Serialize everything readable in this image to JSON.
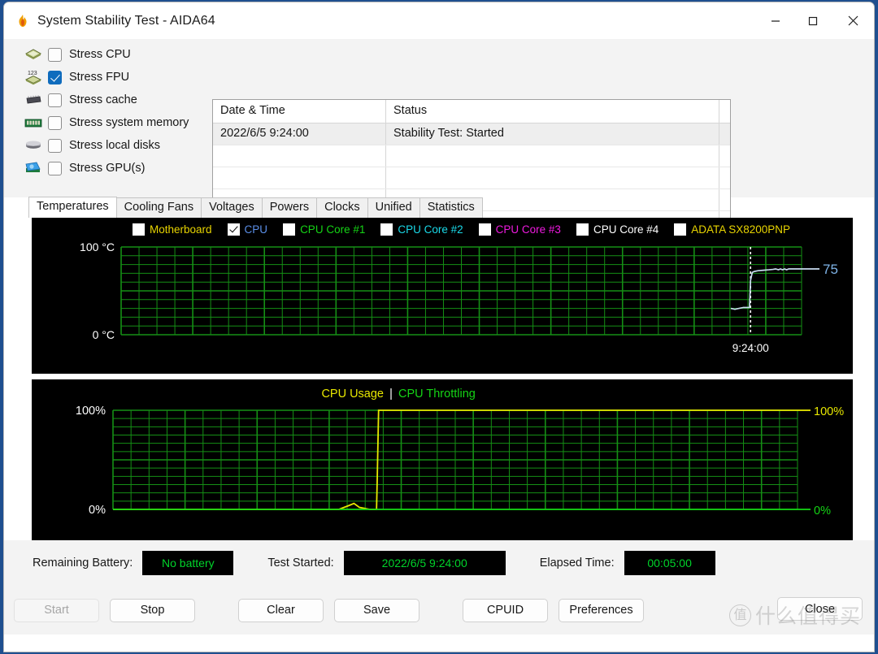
{
  "window": {
    "title": "System Stability Test - AIDA64",
    "icon": "flame-icon",
    "controls": {
      "minimize": "—",
      "maximize": "☐",
      "close": "✕"
    }
  },
  "stress_options": [
    {
      "label": "Stress CPU",
      "checked": false,
      "icon": "cpu-chip-icon"
    },
    {
      "label": "Stress FPU",
      "checked": true,
      "icon": "fpu-chip-icon"
    },
    {
      "label": "Stress cache",
      "checked": false,
      "icon": "cache-chip-icon"
    },
    {
      "label": "Stress system memory",
      "checked": false,
      "icon": "memory-module-icon"
    },
    {
      "label": "Stress local disks",
      "checked": false,
      "icon": "hard-disk-icon"
    },
    {
      "label": "Stress GPU(s)",
      "checked": false,
      "icon": "gpu-card-icon"
    }
  ],
  "log_table": {
    "columns": [
      "Date & Time",
      "Status"
    ],
    "rows": [
      {
        "datetime": "2022/6/5 9:24:00",
        "status": "Stability Test: Started",
        "selected": true
      },
      {
        "datetime": "",
        "status": "",
        "selected": false
      },
      {
        "datetime": "",
        "status": "",
        "selected": false
      },
      {
        "datetime": "",
        "status": "",
        "selected": false
      },
      {
        "datetime": "",
        "status": "",
        "selected": false
      }
    ]
  },
  "tabs": [
    {
      "label": "Temperatures",
      "active": true
    },
    {
      "label": "Cooling Fans",
      "active": false
    },
    {
      "label": "Voltages",
      "active": false
    },
    {
      "label": "Powers",
      "active": false
    },
    {
      "label": "Clocks",
      "active": false
    },
    {
      "label": "Unified",
      "active": false
    },
    {
      "label": "Statistics",
      "active": false
    }
  ],
  "temperature_legend": [
    {
      "label": "Motherboard",
      "checked": false,
      "color": "#e8d400"
    },
    {
      "label": "CPU",
      "checked": true,
      "color": "#5b8fe8"
    },
    {
      "label": "CPU Core #1",
      "checked": false,
      "color": "#15d415"
    },
    {
      "label": "CPU Core #2",
      "checked": false,
      "color": "#1ad9e8"
    },
    {
      "label": "CPU Core #3",
      "checked": false,
      "color": "#f01ae0"
    },
    {
      "label": "CPU Core #4",
      "checked": false,
      "color": "#ffffff"
    },
    {
      "label": "ADATA SX8200PNP",
      "checked": false,
      "color": "#e8d400"
    }
  ],
  "usage_legend": [
    {
      "label": "CPU Usage",
      "color": "#e8e800"
    },
    {
      "label": "|",
      "color": "#ffffff"
    },
    {
      "label": "CPU Throttling",
      "color": "#15d415"
    }
  ],
  "status_fields": [
    {
      "label": "Remaining Battery:",
      "value": "No battery",
      "value_color": "#00d42a"
    },
    {
      "label": "Test Started:",
      "value": "2022/6/5 9:24:00",
      "value_color": "#00d42a"
    },
    {
      "label": "Elapsed Time:",
      "value": "00:05:00",
      "value_color": "#00d42a"
    }
  ],
  "buttons": [
    {
      "label": "Start",
      "disabled": true
    },
    {
      "label": "Stop",
      "disabled": false
    },
    {
      "label": "Clear",
      "disabled": false
    },
    {
      "label": "Save",
      "disabled": false
    },
    {
      "label": "CPUID",
      "disabled": false
    },
    {
      "label": "Preferences",
      "disabled": false
    },
    {
      "label": "Close",
      "disabled": false
    }
  ],
  "watermark": {
    "mark": "值",
    "text": "什么值得买"
  },
  "chart_data": [
    {
      "type": "line",
      "title": "Temperatures",
      "id": "temperature-graph",
      "ylabel": "",
      "ytick_labels": [
        "100 °C",
        "0 °C"
      ],
      "ylim": [
        0,
        100
      ],
      "xlabel": "",
      "xtick_labels": [
        "9:24:00"
      ],
      "grid": true,
      "grid_color": "#158f15",
      "background": "#000000",
      "marker_line": {
        "label": "9:24:00",
        "x_fraction": 0.925,
        "style": "dotted-white"
      },
      "right_value_label": {
        "text": "75",
        "color": "#7fb4e8"
      },
      "series": [
        {
          "name": "CPU",
          "color": "#c8dcf0",
          "current_value": 75,
          "points": [
            {
              "x": 0.896,
              "y": 30
            },
            {
              "x": 0.902,
              "y": 29
            },
            {
              "x": 0.908,
              "y": 30
            },
            {
              "x": 0.914,
              "y": 31
            },
            {
              "x": 0.92,
              "y": 31
            },
            {
              "x": 0.9235,
              "y": 31
            },
            {
              "x": 0.925,
              "y": 62
            },
            {
              "x": 0.9275,
              "y": 71
            },
            {
              "x": 0.93,
              "y": 72
            },
            {
              "x": 0.936,
              "y": 73
            },
            {
              "x": 0.944,
              "y": 73.5
            },
            {
              "x": 0.952,
              "y": 74
            },
            {
              "x": 0.958,
              "y": 74.5
            },
            {
              "x": 0.962,
              "y": 75
            },
            {
              "x": 0.966,
              "y": 74
            },
            {
              "x": 0.969,
              "y": 75
            },
            {
              "x": 0.972,
              "y": 74
            },
            {
              "x": 0.975,
              "y": 75
            },
            {
              "x": 0.978,
              "y": 74
            },
            {
              "x": 0.981,
              "y": 75
            },
            {
              "x": 0.99,
              "y": 75
            },
            {
              "x": 1.0,
              "y": 75
            }
          ]
        }
      ]
    },
    {
      "type": "line",
      "title": "CPU Usage | CPU Throttling",
      "id": "cpu-usage-graph",
      "ylim": [
        0,
        100
      ],
      "ytick_labels_left": [
        "100%",
        "0%"
      ],
      "ytick_labels_right": [
        "100%",
        "0%"
      ],
      "grid": true,
      "grid_color": "#158f15",
      "background": "#000000",
      "series": [
        {
          "name": "CPU Usage",
          "color": "#e8e800",
          "current_value": 100,
          "points": [
            {
              "x": 0.0,
              "y": 0
            },
            {
              "x": 0.33,
              "y": 0
            },
            {
              "x": 0.345,
              "y": 4
            },
            {
              "x": 0.352,
              "y": 6
            },
            {
              "x": 0.36,
              "y": 2
            },
            {
              "x": 0.375,
              "y": 0
            },
            {
              "x": 0.385,
              "y": 0
            },
            {
              "x": 0.386,
              "y": 30
            },
            {
              "x": 0.388,
              "y": 100
            },
            {
              "x": 0.4,
              "y": 100
            },
            {
              "x": 1.0,
              "y": 100
            }
          ]
        },
        {
          "name": "CPU Throttling",
          "color": "#15d415",
          "current_value": 0,
          "points": [
            {
              "x": 0.0,
              "y": 0
            },
            {
              "x": 1.0,
              "y": 0
            }
          ]
        }
      ]
    }
  ]
}
